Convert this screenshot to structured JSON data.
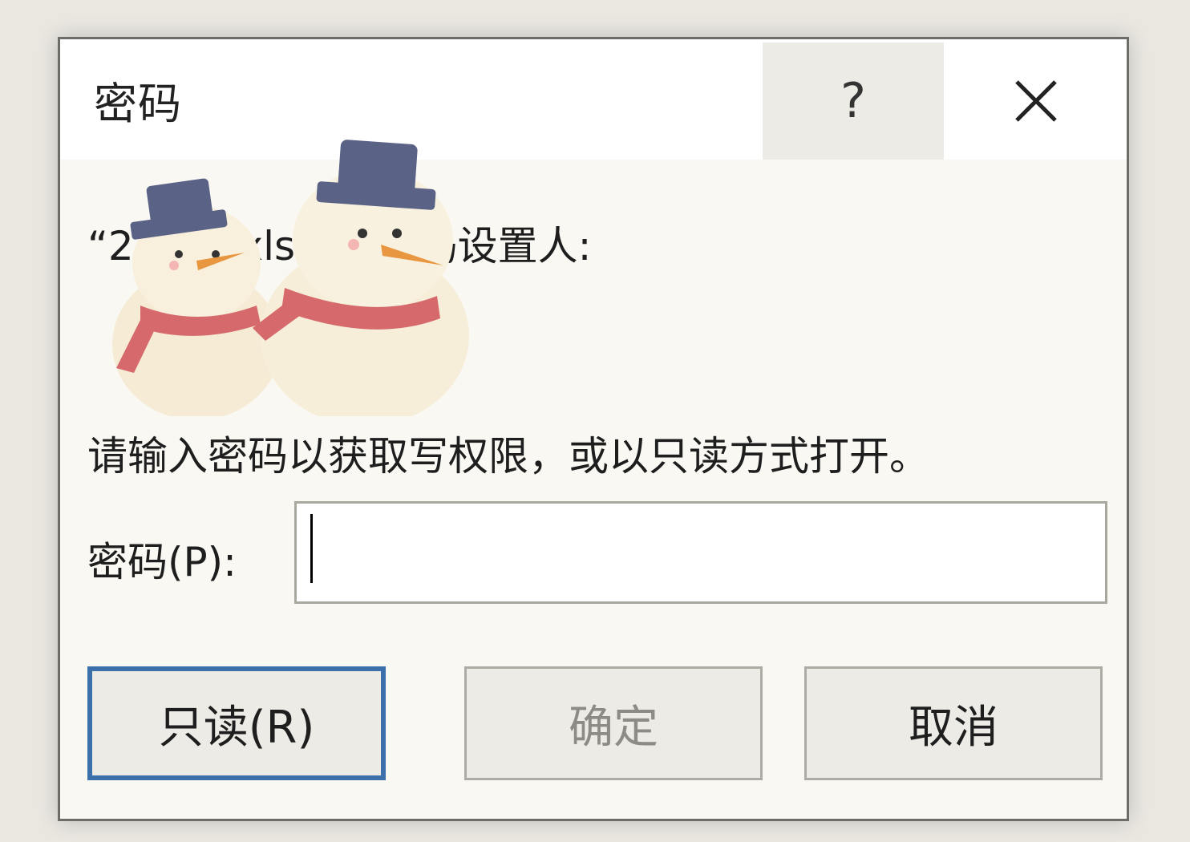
{
  "dialog": {
    "title": "密码",
    "help_label": "?",
    "message": "“2        录数.xlsx\"的密码设置人:",
    "instruction": "请输入密码以获取写权限，或以只读方式打开。",
    "password_label": "密码(P):",
    "password_value": "",
    "buttons": {
      "readonly": "只读(R)",
      "ok": "确定",
      "cancel": "取消"
    }
  },
  "colors": {
    "focus_border": "#3b70aa",
    "disabled_text": "#8c8b84"
  },
  "icons": {
    "close": "close-icon",
    "decoration": "snowmen-sticker"
  }
}
